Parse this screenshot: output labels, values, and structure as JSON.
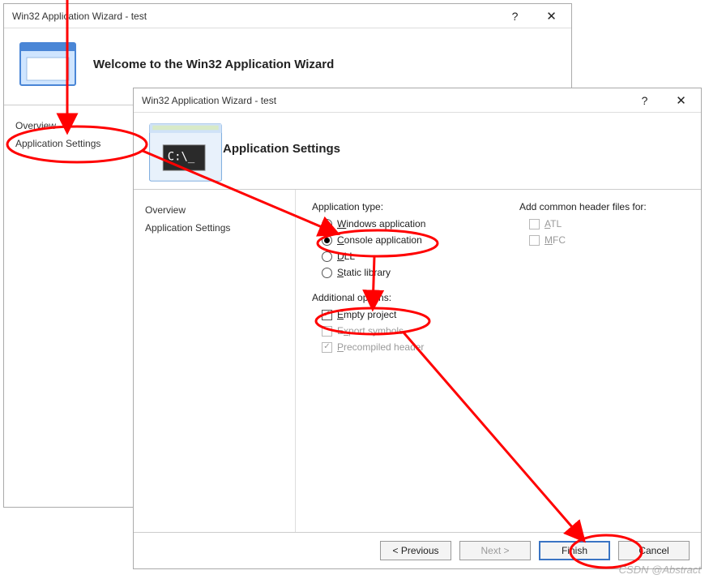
{
  "w1": {
    "title": "Win32 Application Wizard - test",
    "heading": "Welcome to the Win32 Application Wizard",
    "sidebar": {
      "overview": "Overview",
      "appsettings": "Application Settings"
    }
  },
  "w2": {
    "title": "Win32 Application Wizard - test",
    "heading": "Application Settings",
    "sidebar": {
      "overview": "Overview",
      "appsettings": "Application Settings"
    },
    "apptype": {
      "title": "Application type:",
      "windows_app": "Windows application",
      "console_app": "Console application",
      "dll": "DLL",
      "static_lib": "Static library",
      "selected": "console_app"
    },
    "additional": {
      "title": "Additional options:",
      "empty_project": "Empty project",
      "export_symbols": "Export symbols",
      "precompiled": "Precompiled header"
    },
    "headerfiles": {
      "title": "Add common header files for:",
      "atl": "ATL",
      "mfc": "MFC"
    },
    "buttons": {
      "prev": "< Previous",
      "next": "Next >",
      "finish": "Finish",
      "cancel": "Cancel"
    }
  },
  "watermark": "CSDN @Abstract"
}
